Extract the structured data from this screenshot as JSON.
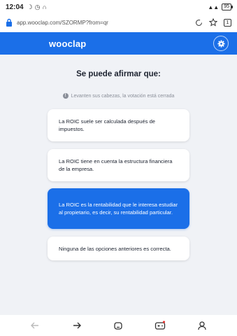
{
  "status_bar": {
    "time": "12:04",
    "icons": [
      "moon-icon",
      "alarm-icon",
      "headset-icon"
    ],
    "signal_text": "ᴴᴰ",
    "battery": "95"
  },
  "browser": {
    "url": "app.wooclap.com/SZORMP?from=qr",
    "tab_count": "1"
  },
  "app_header": {
    "logo": "wooclap"
  },
  "main": {
    "question": "Se puede afirmar que:",
    "notice": "Levanten sus cabezas, la votación está cerrada",
    "options": [
      {
        "label": "La ROIC suele ser calculada después de impuestos.",
        "selected": false
      },
      {
        "label": "La ROIC tiene en cuenta la estructura financiera de la empresa.",
        "selected": false
      },
      {
        "label": "La ROIC es la rentabilidad que le interesa estudiar al propietario, es decir, su rentabilidad particular.",
        "selected": true
      },
      {
        "label": "Ninguna de las opciones anteriores es correcta.",
        "selected": false
      }
    ]
  },
  "colors": {
    "brand_blue": "#1b6fe8",
    "background": "#f0f2f6"
  }
}
